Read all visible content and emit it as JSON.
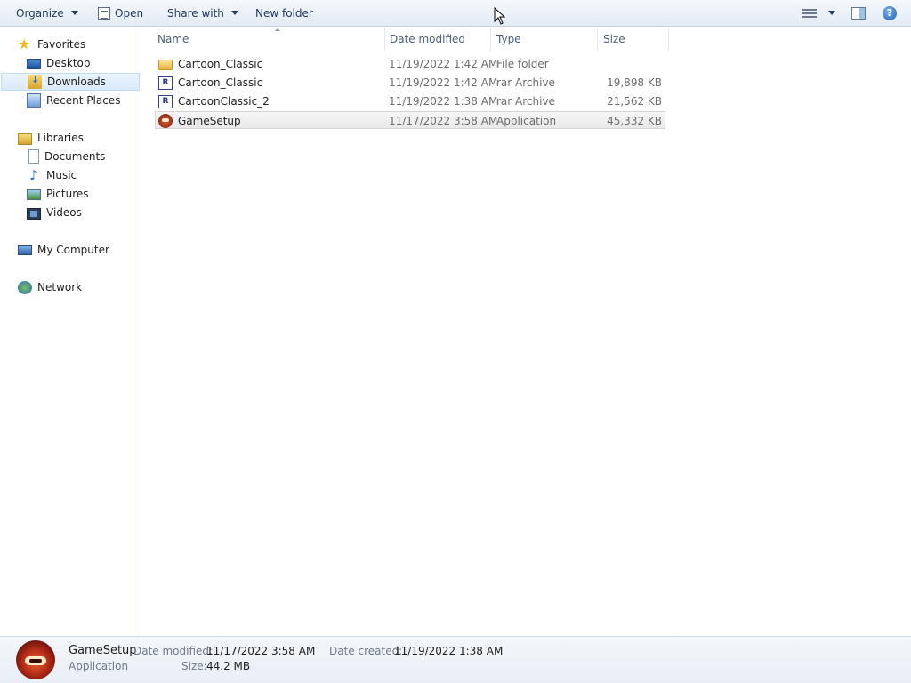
{
  "toolbar": {
    "organize_label": "Organize",
    "open_label": "Open",
    "share_label": "Share with",
    "new_folder_label": "New folder"
  },
  "nav": {
    "favorites": "Favorites",
    "desktop": "Desktop",
    "downloads": "Downloads",
    "recent": "Recent Places",
    "libraries": "Libraries",
    "documents": "Documents",
    "music": "Music",
    "pictures": "Pictures",
    "videos": "Videos",
    "computer": "My Computer",
    "network": "Network",
    "selected": "Downloads"
  },
  "columns": {
    "name": "Name",
    "date": "Date modified",
    "type": "Type",
    "size": "Size"
  },
  "files": [
    {
      "name": "Cartoon_Classic",
      "date": "11/19/2022 1:42 AM",
      "type": "File folder",
      "size": "",
      "icon": "folder-icon"
    },
    {
      "name": "Cartoon_Classic",
      "date": "11/19/2022 1:42 AM",
      "type": "rar Archive",
      "size": "19,898 KB",
      "icon": "rar-archive-icon"
    },
    {
      "name": "CartoonClassic_2",
      "date": "11/19/2022 1:38 AM",
      "type": "rar Archive",
      "size": "21,562 KB",
      "icon": "rar-archive-icon"
    },
    {
      "name": "GameSetup",
      "date": "11/17/2022 3:58 AM",
      "type": "Application",
      "size": "45,332 KB",
      "icon": "application-icon",
      "selected": true
    }
  ],
  "details": {
    "name": "GameSetup",
    "type": "Application",
    "modified_label": "Date modified:",
    "modified_value": "11/17/2022 3:58 AM",
    "size_label": "Size:",
    "size_value": "44.2 MB",
    "created_label": "Date created:",
    "created_value": "11/19/2022 1:38 AM"
  },
  "colors": {
    "toolbar_text": "#1e395b",
    "selection": "#dbeafb",
    "meta_text": "#6d6d6d"
  }
}
